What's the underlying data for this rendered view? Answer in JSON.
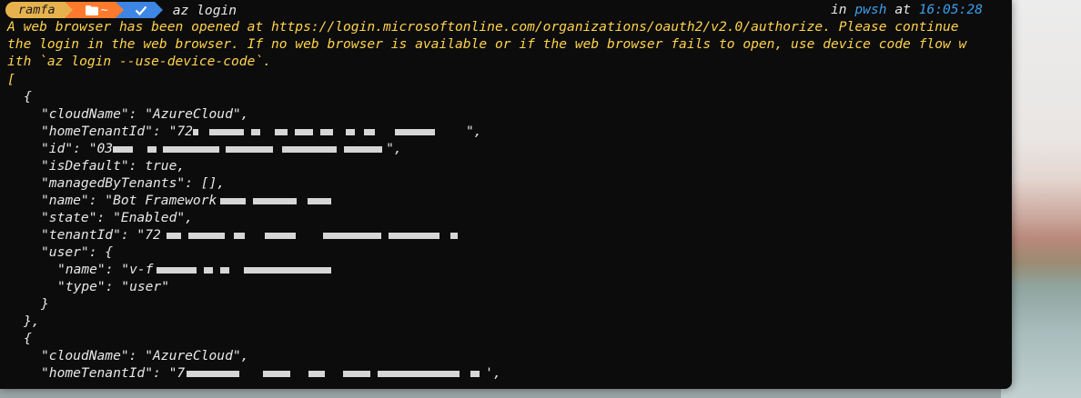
{
  "prompt": {
    "user": "ramfa",
    "path_icon": "folder-icon",
    "path": "~",
    "git_icon": "check-icon",
    "command": "az login",
    "right": {
      "in": "in",
      "shell": "pwsh",
      "at": "at",
      "time": "16:05:28"
    }
  },
  "message": [
    "A web browser has been opened at https://login.microsoftonline.com/organizations/oauth2/v2.0/authorize. Please continue",
    "the login in the web browser. If no web browser is available or if the web browser fails to open, use device code flow w",
    "ith `az login --use-device-code`."
  ],
  "output": {
    "open_bracket": "[",
    "account1": {
      "open": "{",
      "cloudName": "\"cloudName\": \"AzureCloud\",",
      "homeTenantId": "\"homeTenantId\": \"72",
      "id": "\"id\": \"03",
      "isDefault": "\"isDefault\": true,",
      "managedByTenants": "\"managedByTenants\": [],",
      "name": "\"name\": \"Bot Framework",
      "state": "\"state\": \"Enabled\",",
      "tenantId": "\"tenantId\": \"72",
      "user_open": "\"user\": {",
      "user_name": "\"name\": \"v-f",
      "user_type": "\"type\": \"user\"",
      "user_close": "}",
      "close": "},"
    },
    "account2": {
      "open": "{",
      "cloudName": "\"cloudName\": \"AzureCloud\",",
      "homeTenantId": "\"homeTenantId\": \"7"
    }
  },
  "colors": {
    "background": "#0c0c0c",
    "message": "#ffd34d",
    "user_segment": "#e7b24e",
    "path_segment": "#ff7a2c",
    "git_segment": "#3d86e3",
    "time": "#3d9ee8"
  }
}
